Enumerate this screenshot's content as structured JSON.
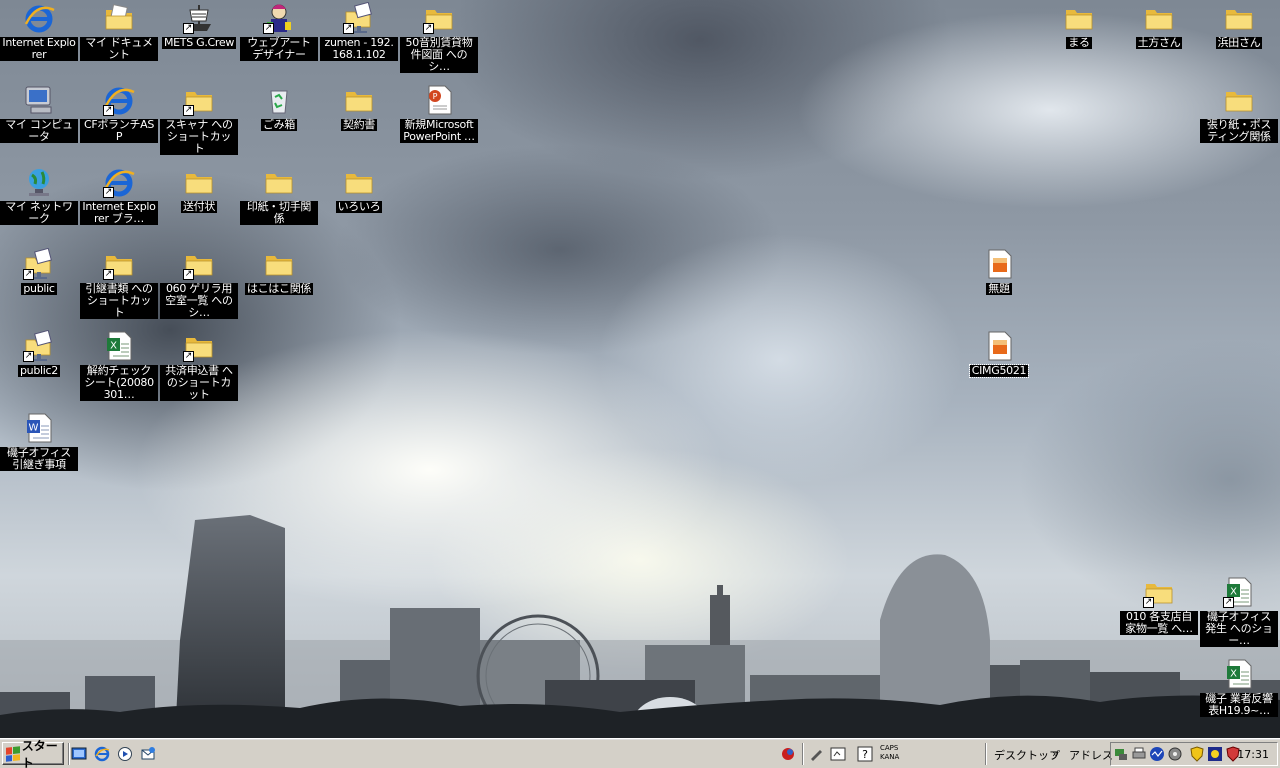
{
  "desktop": {
    "icons": [
      {
        "name": "internet-explorer-icon",
        "label": "Internet Explorer",
        "icon": "ie-icon",
        "shortcut": false
      },
      {
        "name": "my-documents-icon",
        "label": "マイ ドキュメント",
        "icon": "documents-folder-icon",
        "shortcut": false
      },
      {
        "name": "mets-gcrew-icon",
        "label": "METS G.Crew",
        "icon": "ship-icon",
        "shortcut": true
      },
      {
        "name": "web-art-designer-icon",
        "label": "ウェブアート デザイナー",
        "icon": "designer-icon",
        "shortcut": true
      },
      {
        "name": "zumen-share-icon",
        "label": "zumen - 192.168.1.102",
        "icon": "network-folder-icon",
        "shortcut": true
      },
      {
        "name": "fifty-sound-folder-icon",
        "label": "50音別賃貸物件図面 へのシ…",
        "icon": "folder-icon",
        "shortcut": true
      },
      {
        "name": "maru-folder-icon",
        "label": "まる",
        "icon": "folder-icon",
        "shortcut": false
      },
      {
        "name": "hijikata-folder-icon",
        "label": "土方さん",
        "icon": "folder-icon",
        "shortcut": false
      },
      {
        "name": "hamada-folder-icon",
        "label": "浜田さん",
        "icon": "folder-icon",
        "shortcut": false
      },
      {
        "name": "my-computer-icon",
        "label": "マイ コンピュータ",
        "icon": "computer-icon",
        "shortcut": false
      },
      {
        "name": "cf-asp-icon",
        "label": "CFボランチASP",
        "icon": "ie-icon",
        "shortcut": true
      },
      {
        "name": "scanner-shortcut-icon",
        "label": "スキャナ へのショートカット",
        "icon": "folder-icon",
        "shortcut": true
      },
      {
        "name": "recycle-bin-icon",
        "label": "ごみ箱",
        "icon": "recycle-bin-icon",
        "shortcut": false
      },
      {
        "name": "contracts-folder-icon",
        "label": "契約書",
        "icon": "folder-icon",
        "shortcut": false
      },
      {
        "name": "powerpoint-file-icon",
        "label": "新規Microsoft PowerPoint …",
        "icon": "powerpoint-icon",
        "shortcut": false
      },
      {
        "name": "bulletin-folder-icon",
        "label": "張り紙・ポスティング関係",
        "icon": "folder-icon",
        "shortcut": false
      },
      {
        "name": "my-network-icon",
        "label": "マイ ネットワーク",
        "icon": "network-icon",
        "shortcut": false
      },
      {
        "name": "ie-browser-shortcut-icon",
        "label": "Internet Explorer ブラ…",
        "icon": "ie-icon",
        "shortcut": true
      },
      {
        "name": "cover-letter-folder-icon",
        "label": "送付状",
        "icon": "folder-icon",
        "shortcut": false
      },
      {
        "name": "stamps-folder-icon",
        "label": "印紙・切手関係",
        "icon": "folder-icon",
        "shortcut": false
      },
      {
        "name": "misc-folder-icon",
        "label": "いろいろ",
        "icon": "folder-icon",
        "shortcut": false
      },
      {
        "name": "public-share-icon",
        "label": "public",
        "icon": "network-folder-icon",
        "shortcut": true
      },
      {
        "name": "handover-docs-icon",
        "label": "引継書類 へのショートカット",
        "icon": "folder-icon",
        "shortcut": true
      },
      {
        "name": "guerrilla-vacancy-icon",
        "label": "060 ゲリラ用空室一覧 へのシ…",
        "icon": "folder-icon",
        "shortcut": true
      },
      {
        "name": "hakobako-folder-icon",
        "label": "はこはこ関係",
        "icon": "folder-icon",
        "shortcut": false
      },
      {
        "name": "untitled-image-icon",
        "label": "無題",
        "icon": "image-file-icon",
        "shortcut": false
      },
      {
        "name": "public2-share-icon",
        "label": "public2",
        "icon": "network-folder-icon",
        "shortcut": true
      },
      {
        "name": "cancel-check-sheet-icon",
        "label": "解約チェックシート(20080301…",
        "icon": "excel-icon",
        "shortcut": false
      },
      {
        "name": "mutual-aid-form-icon",
        "label": "共済申込書 へのショートカット",
        "icon": "folder-icon",
        "shortcut": true
      },
      {
        "name": "cimg5021-icon",
        "label": "CIMG5021",
        "icon": "image-file-icon",
        "shortcut": false,
        "selected": true
      },
      {
        "name": "isogo-office-handover-icon",
        "label": "磯子オフィス引継ぎ事項",
        "icon": "word-icon",
        "shortcut": false
      },
      {
        "name": "branch-list-icon",
        "label": "010 各支店自家物一覧 へ…",
        "icon": "folder-icon",
        "shortcut": true
      },
      {
        "name": "isogo-office-shortcut-icon",
        "label": "磯子オフィス発生 へのショー…",
        "icon": "excel-icon",
        "shortcut": true
      },
      {
        "name": "isogo-vendor-icon",
        "label": "磯子 業者反響表H19.9~…",
        "icon": "excel-icon",
        "shortcut": false
      }
    ]
  },
  "taskbar": {
    "start_label": "スタート",
    "caps_line1": "CAPS",
    "caps_line2": "KANA",
    "desktop_label": "デスクトップ",
    "chevron": "»",
    "address_label": "アドレス",
    "clock": "17:31",
    "quick_launch": [
      "show-desktop-icon",
      "ie-icon",
      "media-player-icon",
      "outlook-express-icon"
    ],
    "tray_icons": [
      "network-status-icon",
      "printer-icon",
      "monitor-icon",
      "speaker-icon",
      "shield-icon",
      "antivirus-icon",
      "security-icon"
    ]
  },
  "colors": {
    "label_bg": "#000000",
    "label_text": "#ffffff",
    "taskbar_bg": "#d4d0c8",
    "folder": "#f3d36b"
  }
}
